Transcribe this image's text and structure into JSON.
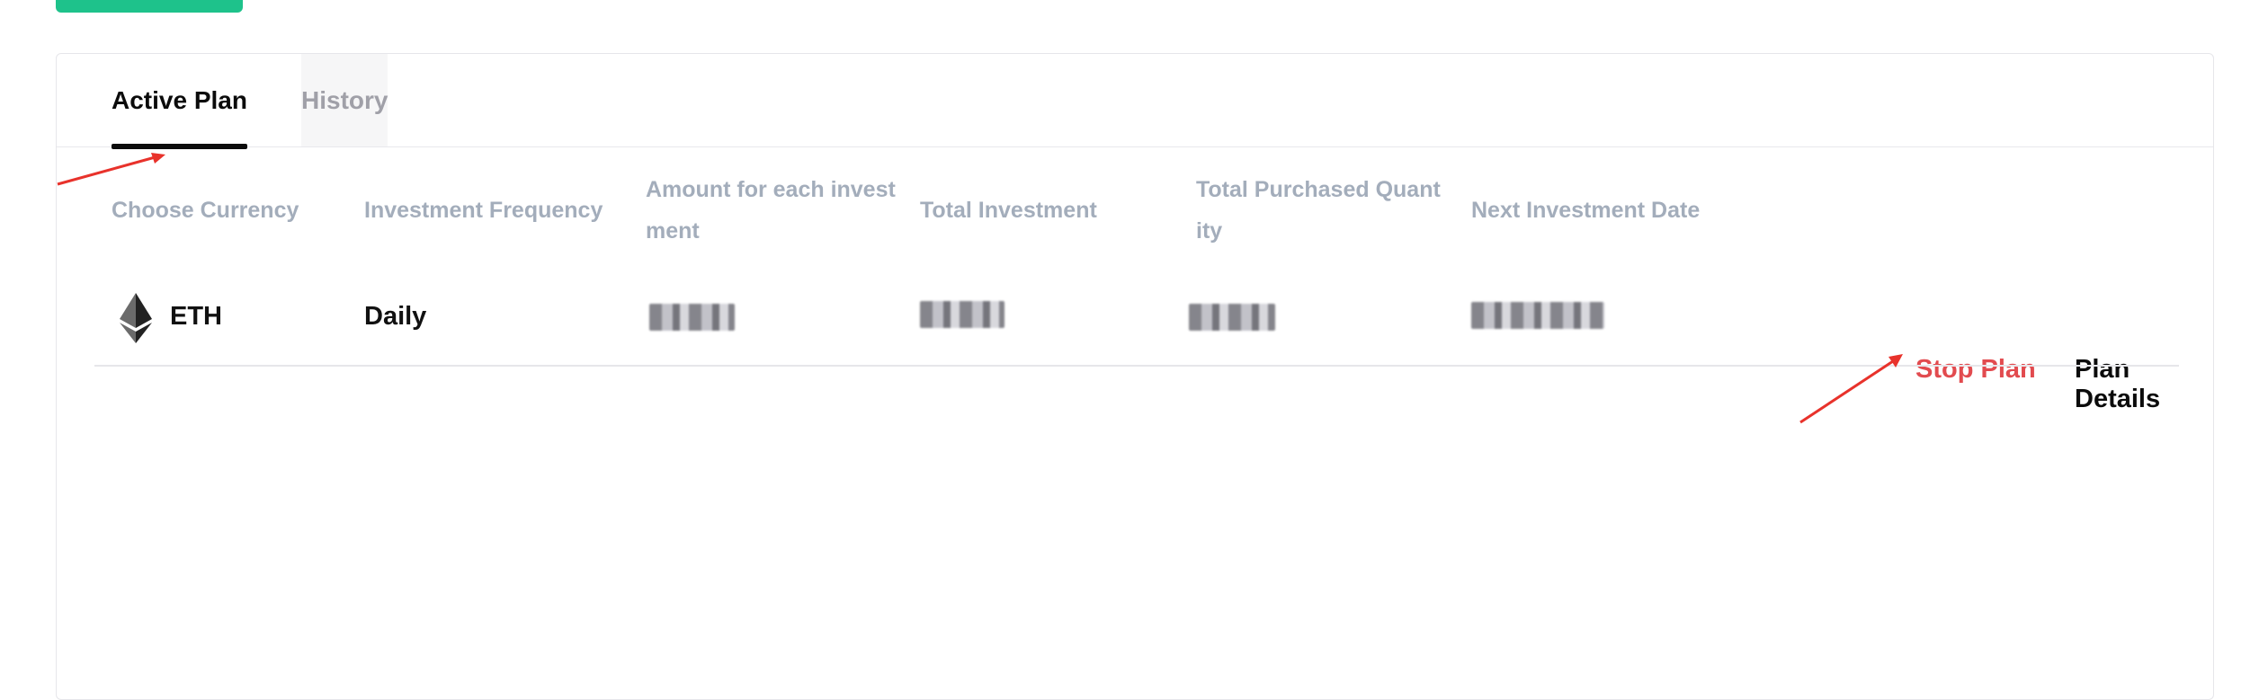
{
  "tabs": {
    "active_label": "Active Plan",
    "history_label": "History"
  },
  "table": {
    "headers": {
      "currency": "Choose Currency",
      "frequency": "Investment Frequency",
      "amount_line1": "Amount for each invest",
      "amount_line2": "ment",
      "total_investment": "Total Investment",
      "purchased_line1": "Total Purchased Quant",
      "purchased_line2": "ity",
      "next_date": "Next Investment Date"
    },
    "row": {
      "currency_icon": "ethereum-icon",
      "currency": "ETH",
      "frequency": "Daily",
      "actions": {
        "stop": "Stop Plan",
        "details": "Plan Details"
      }
    }
  },
  "colors": {
    "accent": "#1ec28b",
    "danger": "#e24b4f",
    "header_text": "#a3adbb",
    "annotation_arrow": "#e8322b"
  }
}
